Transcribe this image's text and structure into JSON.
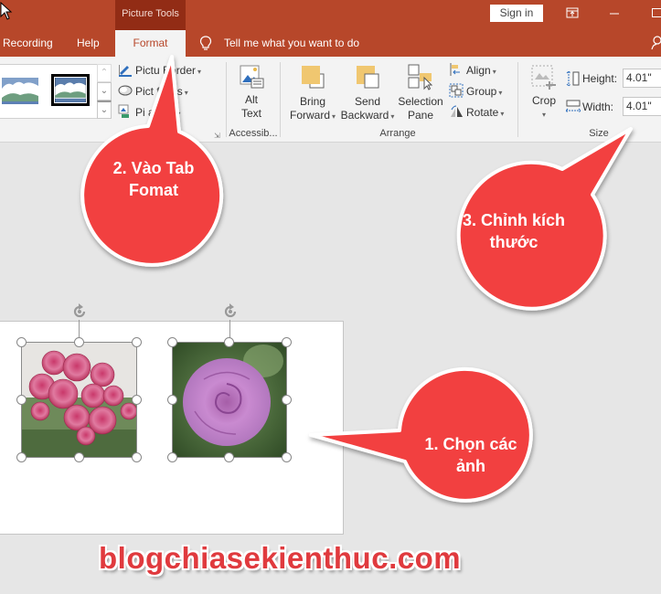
{
  "titlebar": {
    "contextual_group": "Picture Tools",
    "sign_in": "Sign in",
    "ribbon_display_icon": "ribbon-display-options-icon",
    "minimize_icon": "minimize-icon",
    "maximize_icon": "maximize-icon"
  },
  "tabs": [
    {
      "label": "Recording",
      "active": false
    },
    {
      "label": "Help",
      "active": false
    },
    {
      "label": "Format",
      "active": true
    }
  ],
  "tell_me": {
    "icon": "lightbulb-icon",
    "placeholder": "Tell me what you want to do"
  },
  "share_icon": "person-icon",
  "ribbon": {
    "picture_styles": {
      "gallery_icons": [
        "picture-style-soft-edge-icon",
        "picture-style-black-frame-icon"
      ],
      "buttons": [
        {
          "label": "Picture Border",
          "visible_text": "Pictu Border",
          "icon": "picture-border-icon"
        },
        {
          "label": "Picture Effects",
          "visible_text": "Pict ffects",
          "icon": "picture-effects-icon"
        },
        {
          "label": "Picture Layout",
          "visible_text": "Pi ayout",
          "icon": "picture-layout-icon"
        }
      ]
    },
    "accessibility": {
      "group_label": "Accessib...",
      "alt_text": {
        "line1": "Alt",
        "line2": "Text",
        "icon": "alt-text-icon"
      }
    },
    "arrange": {
      "group_label": "Arrange",
      "bring_forward": {
        "line1": "Bring",
        "line2": "Forward",
        "icon": "bring-forward-icon"
      },
      "send_backward": {
        "line1": "Send",
        "line2": "Backward",
        "icon": "send-backward-icon"
      },
      "selection_pane": {
        "line1": "Selection",
        "line2": "Pane",
        "icon": "selection-pane-icon"
      },
      "align": {
        "label": "Align",
        "icon": "align-icon"
      },
      "group": {
        "label": "Group",
        "icon": "group-icon"
      },
      "rotate": {
        "label": "Rotate",
        "icon": "rotate-icon"
      }
    },
    "size": {
      "group_label": "Size",
      "crop": {
        "label": "Crop",
        "icon": "crop-icon"
      },
      "height_label": "Height:",
      "height_value": "4.01\"",
      "width_label": "Width:",
      "width_value": "4.01\""
    }
  },
  "slide": {
    "images": [
      {
        "name": "pink-roses-cluster",
        "selected": true
      },
      {
        "name": "purple-rose",
        "selected": true
      }
    ]
  },
  "callouts": [
    {
      "id": "step2",
      "line1": "2. Vào Tab",
      "line2": "Fomat"
    },
    {
      "id": "step3",
      "line1": "3. Chỉnh kích",
      "line2": "thước"
    },
    {
      "id": "step1",
      "line1": "1. Chọn các",
      "line2": "ảnh"
    }
  ],
  "colors": {
    "ribbon_accent": "#b7472a",
    "contextual_tab": "#922c15",
    "callout_red": "#f2403f"
  },
  "watermark": "blogchiasekienthuc.com"
}
